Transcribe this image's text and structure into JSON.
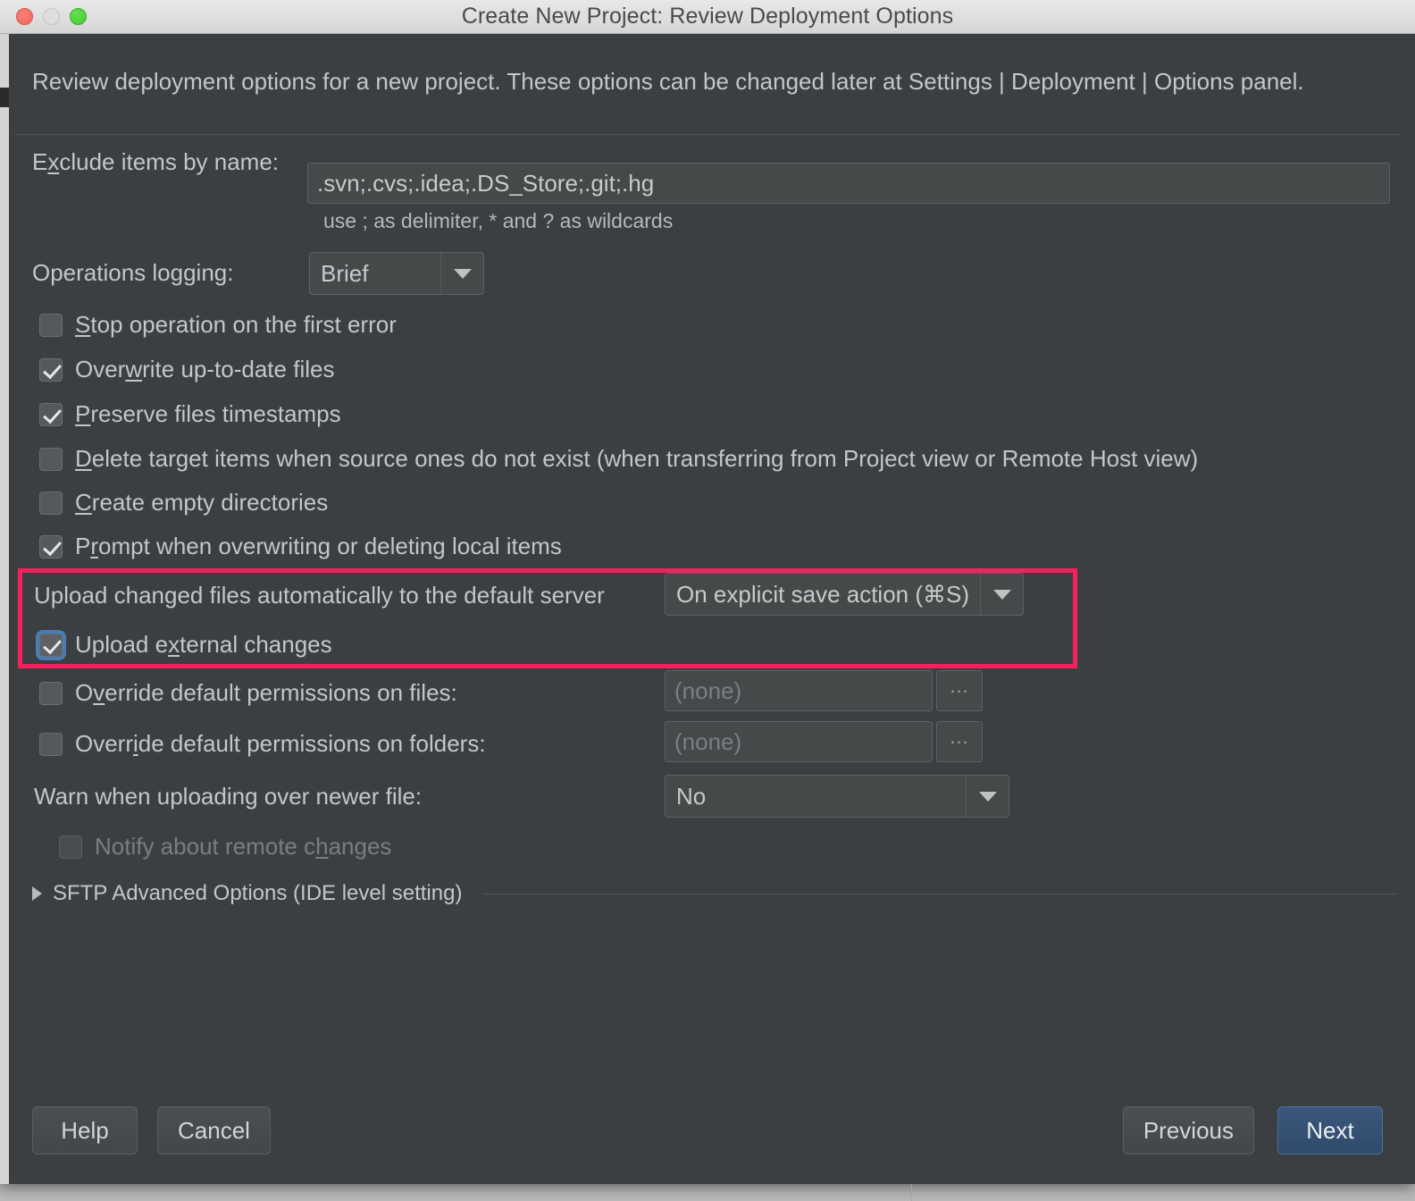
{
  "window": {
    "title": "Create New Project: Review Deployment Options",
    "traffic_lights": [
      "close-light",
      "minimize-light",
      "zoom-light"
    ]
  },
  "description": "Review deployment options for a new project. These options can be changed later at Settings | Deployment | Options panel.",
  "form": {
    "exclude": {
      "label_pre": "E",
      "label_mnemonic": "x",
      "label_post": "clude items by name:",
      "label_full": "Exclude items by name:",
      "value": ".svn;.cvs;.idea;.DS_Store;.git;.hg",
      "hint": "use ; as delimiter, * and ? as wildcards"
    },
    "operations_logging": {
      "label": "Operations logging:",
      "value": "Brief"
    },
    "checkboxes": [
      {
        "pre": "",
        "mnemonic": "S",
        "post": "top operation on the first error",
        "checked": false,
        "disabled": false,
        "focused": false
      },
      {
        "pre": "Over",
        "mnemonic": "w",
        "post": "rite up-to-date files",
        "checked": true,
        "disabled": false,
        "focused": false
      },
      {
        "pre": "",
        "mnemonic": "P",
        "post": "reserve files timestamps",
        "checked": true,
        "disabled": false,
        "focused": false
      },
      {
        "pre": "",
        "mnemonic": "D",
        "post": "elete target items when source ones do not exist (when transferring from Project view or Remote Host view)",
        "checked": false,
        "disabled": false,
        "focused": false
      },
      {
        "pre": "",
        "mnemonic": "C",
        "post": "reate empty directories",
        "checked": false,
        "disabled": false,
        "focused": false
      },
      {
        "pre": "P",
        "mnemonic": "r",
        "post": "ompt when overwriting or deleting local items",
        "checked": true,
        "disabled": false,
        "focused": false
      }
    ],
    "upload_auto": {
      "label": "Upload changed files automatically to the default server",
      "value": "On explicit save action (⌘S)"
    },
    "upload_external": {
      "pre": "Upload e",
      "mnemonic": "x",
      "post": "ternal changes",
      "checked": true,
      "focused": true
    },
    "override_files": {
      "pre": "O",
      "mnemonic": "v",
      "post": "erride default permissions on files:",
      "checked": false,
      "value": "(none)",
      "browse_label": "..."
    },
    "override_folders": {
      "pre": "Overr",
      "mnemonic": "i",
      "post": "de default permissions on folders:",
      "checked": false,
      "value": "(none)",
      "browse_label": "..."
    },
    "warn_newer": {
      "label": "Warn when uploading over newer file:",
      "value": "No"
    },
    "notify_remote": {
      "pre": "Notify about remote c",
      "mnemonic": "h",
      "post": "anges",
      "checked": false,
      "disabled": true
    },
    "sftp_advanced": {
      "label": "SFTP Advanced Options (IDE level setting)",
      "expanded": false
    }
  },
  "footer": {
    "help": "Help",
    "cancel": "Cancel",
    "previous": "Previous",
    "next": "Next"
  },
  "colors": {
    "dialog_bg": "#3c3f41",
    "titlebar_bg": "#e0e0e0",
    "text": "#c4c6c7",
    "disabled_text": "#7b7e80",
    "highlight_border": "#f4215e",
    "primary_button": "#35527a",
    "focus_ring": "#4b87c8"
  }
}
